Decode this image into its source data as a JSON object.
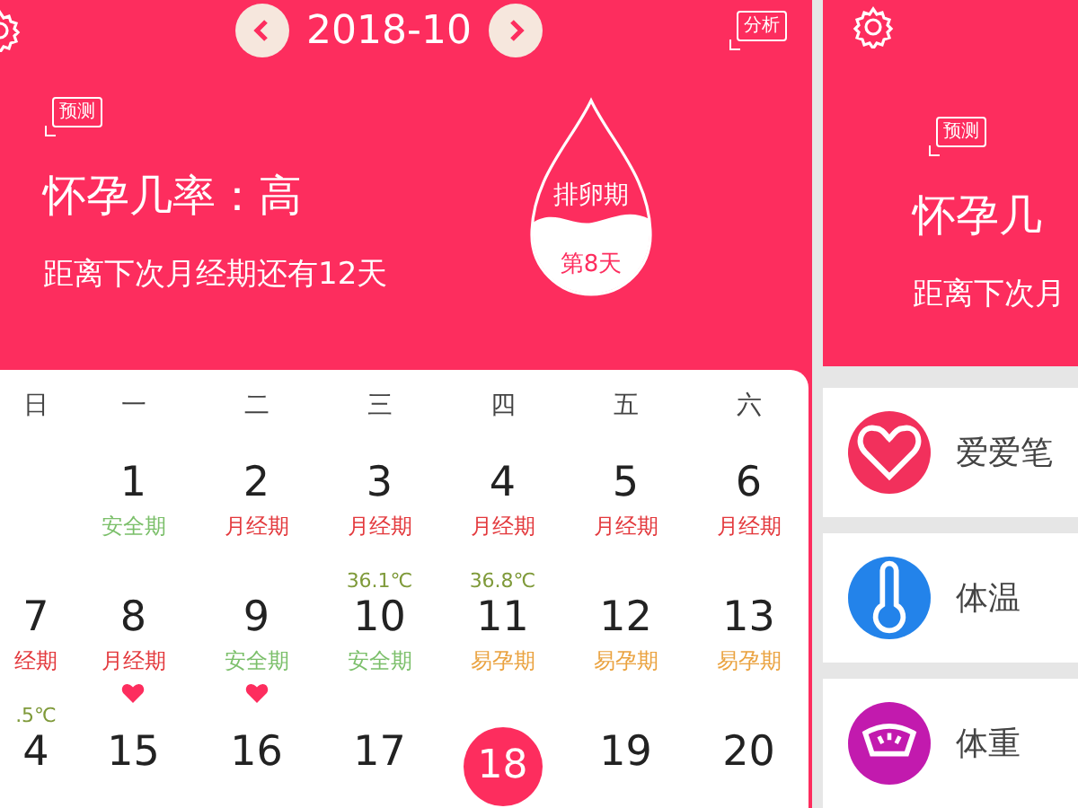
{
  "left_screen": {
    "header": {
      "month": "2018-10",
      "analysis_button": "分析",
      "forecast_badge": "预测",
      "pregnancy_chance": "怀孕几率：高",
      "next_period": "距离下次月经期还有12天",
      "phase_drop": {
        "phase": "排卵期",
        "day": "第8天"
      }
    },
    "calendar": {
      "weekdays": [
        "日",
        "一",
        "二",
        "三",
        "四",
        "五",
        "六"
      ],
      "weeks": [
        [
          {
            "day": "1",
            "phase": {
              "label": "安全期",
              "kind": "safe"
            },
            "today": false
          },
          {
            "day": "2",
            "phase": {
              "label": "月经期",
              "kind": "period"
            },
            "today": false
          },
          {
            "day": "3",
            "phase": {
              "label": "月经期",
              "kind": "period"
            },
            "today": false
          },
          {
            "day": "4",
            "phase": {
              "label": "月经期",
              "kind": "period"
            },
            "today": false
          },
          {
            "day": "5",
            "phase": {
              "label": "月经期",
              "kind": "period"
            },
            "today": false
          },
          {
            "day": "6",
            "phase": {
              "label": "月经期",
              "kind": "period"
            },
            "today": false
          }
        ],
        [
          {
            "day": "7",
            "phase": {
              "label": "经期",
              "kind": "period"
            },
            "today": false
          },
          {
            "day": "8",
            "phase": {
              "label": "月经期",
              "kind": "period"
            },
            "love": true,
            "today": false
          },
          {
            "day": "9",
            "phase": {
              "label": "安全期",
              "kind": "safe"
            },
            "love": true,
            "today": false
          },
          {
            "day": "10",
            "temp": "36.1℃",
            "phase": {
              "label": "安全期",
              "kind": "safe"
            },
            "today": false
          },
          {
            "day": "11",
            "temp": "36.8℃",
            "phase": {
              "label": "易孕期",
              "kind": "fertile"
            },
            "today": false
          },
          {
            "day": "12",
            "phase": {
              "label": "易孕期",
              "kind": "fertile"
            },
            "today": false
          },
          {
            "day": "13",
            "phase": {
              "label": "易孕期",
              "kind": "fertile"
            },
            "today": false
          }
        ],
        [
          {
            "day": "4",
            "temp": ".5℃",
            "today": false
          },
          {
            "day": "15",
            "today": false
          },
          {
            "day": "16",
            "today": false
          },
          {
            "day": "17",
            "today": false
          },
          {
            "day": "18",
            "today": true
          },
          {
            "day": "19",
            "today": false
          },
          {
            "day": "20",
            "today": false
          }
        ]
      ]
    }
  },
  "right_screen": {
    "header": {
      "forecast_badge": "预测",
      "pregnancy_chance": "怀孕几",
      "next_period": "距离下次月"
    },
    "records": [
      {
        "label": "爱爱笔",
        "kind": "heart",
        "color": "#f2305c"
      },
      {
        "label": "体温",
        "kind": "thermometer",
        "color": "#2383ea"
      },
      {
        "label": "体重",
        "kind": "scale",
        "color": "#c21aae"
      }
    ]
  }
}
